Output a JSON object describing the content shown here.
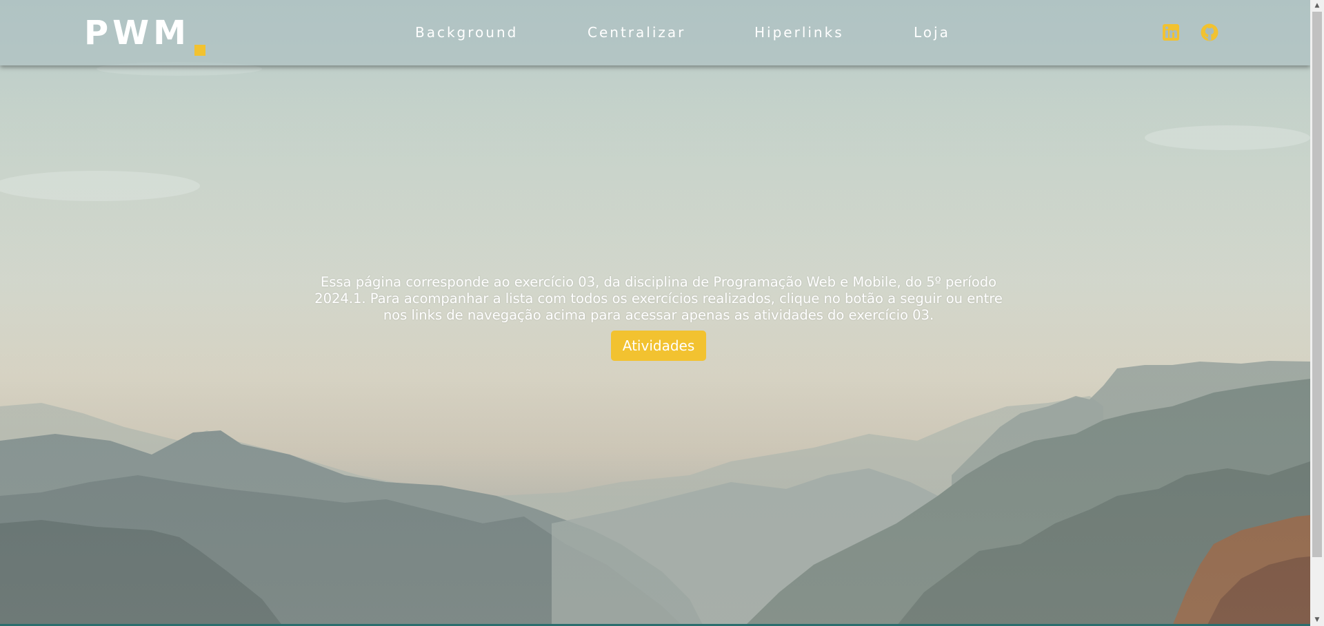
{
  "header": {
    "logo_text": "PWM",
    "nav_links": [
      {
        "label": "Background"
      },
      {
        "label": "Centralizar"
      },
      {
        "label": "Hiperlinks"
      },
      {
        "label": "Loja"
      }
    ],
    "social_icons": [
      "linkedin-icon",
      "github-icon"
    ]
  },
  "main": {
    "intro_text": "Essa página corresponde ao exercício 03, da disciplina de Programação Web e Mobile, do 5º período 2024.1. Para acompanhar a lista com todos os exercícios realizados, clique no botão a seguir ou entre nos links de navegação acima para acessar apenas as atividades do exercício 03.",
    "button_label": "Atividades"
  },
  "colors": {
    "accent": "#f2c230",
    "text": "#ffffff",
    "navbar": "#aabec0"
  }
}
